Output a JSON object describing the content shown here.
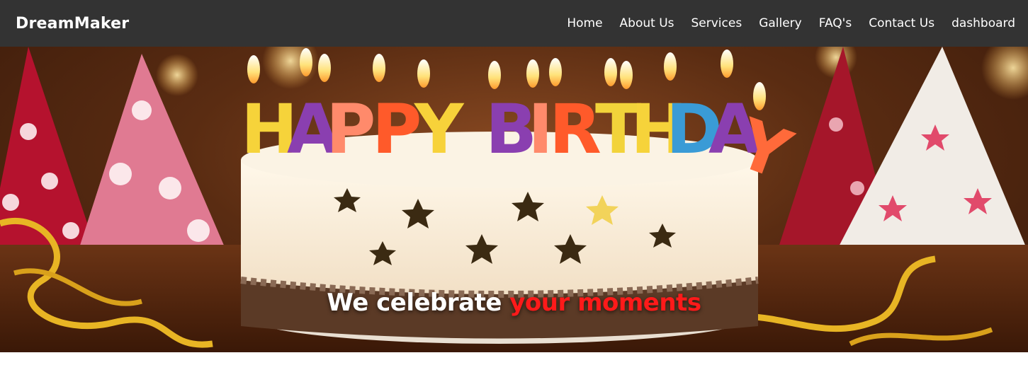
{
  "navbar": {
    "brand": "DreamMaker",
    "links": [
      "Home",
      "About Us",
      "Services",
      "Gallery",
      "FAQ's",
      "Contact Us",
      "dashboard"
    ]
  },
  "hero": {
    "image": "happy-birthday-cake-with-candles",
    "candle_letters": [
      "H",
      "A",
      "P",
      "P",
      "Y",
      "B",
      "I",
      "R",
      "T",
      "H",
      "D",
      "A",
      "Y"
    ],
    "tagline_white": "We celebrate",
    "tagline_red": "your moments"
  },
  "colors": {
    "navbar_bg": "#333333",
    "nav_text": "#ffffff",
    "tagline_accent": "#ff1a1a"
  }
}
